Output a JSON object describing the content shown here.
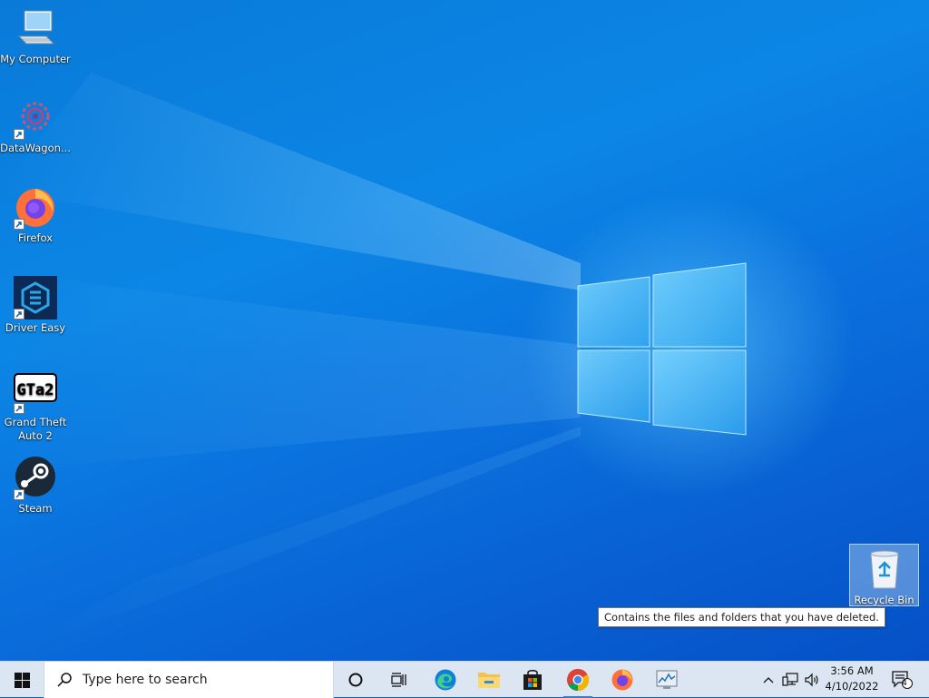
{
  "desktop": {
    "icons": [
      {
        "name": "my-computer",
        "label": "My Computer",
        "icon": "computer-icon",
        "shortcut": false
      },
      {
        "name": "datawagon",
        "label": "DataWagon...",
        "icon": "datawagon-icon",
        "shortcut": true
      },
      {
        "name": "firefox",
        "label": "Firefox",
        "icon": "firefox-icon",
        "shortcut": true
      },
      {
        "name": "driver-easy",
        "label": "Driver Easy",
        "icon": "driver-easy-icon",
        "shortcut": true
      },
      {
        "name": "gta2",
        "label": "Grand Theft Auto 2",
        "icon": "gta2-icon",
        "shortcut": true
      },
      {
        "name": "steam",
        "label": "Steam",
        "icon": "steam-icon",
        "shortcut": true
      }
    ],
    "recycle_bin": {
      "label": "Recycle Bin",
      "icon": "recycle-bin-icon",
      "selected": true
    },
    "tooltip": "Contains the files and folders that you have deleted.",
    "gta2_logo_text": "GTa2"
  },
  "taskbar": {
    "start_icon": "windows-start-icon",
    "search": {
      "placeholder": "Type here to search",
      "icon": "search-icon"
    },
    "cortana_icon": "cortana-icon",
    "task_view_icon": "task-view-icon",
    "pinned": [
      {
        "name": "edge",
        "icon": "edge-icon",
        "active": false
      },
      {
        "name": "file-explorer",
        "icon": "file-explorer-icon",
        "active": false
      },
      {
        "name": "store",
        "icon": "microsoft-store-icon",
        "active": false
      },
      {
        "name": "chrome",
        "icon": "chrome-icon",
        "active": true
      },
      {
        "name": "firefox",
        "icon": "firefox-icon",
        "active": false
      },
      {
        "name": "performance-monitor",
        "icon": "performance-monitor-icon",
        "active": false
      }
    ],
    "tray": {
      "time": "3:56 AM",
      "date": "4/10/2022",
      "notification_count": "4"
    }
  },
  "colors": {
    "accent": "#3b78c8",
    "taskbar_bg": "#dce6f2",
    "desktop_blue": "#0a7ad8"
  }
}
